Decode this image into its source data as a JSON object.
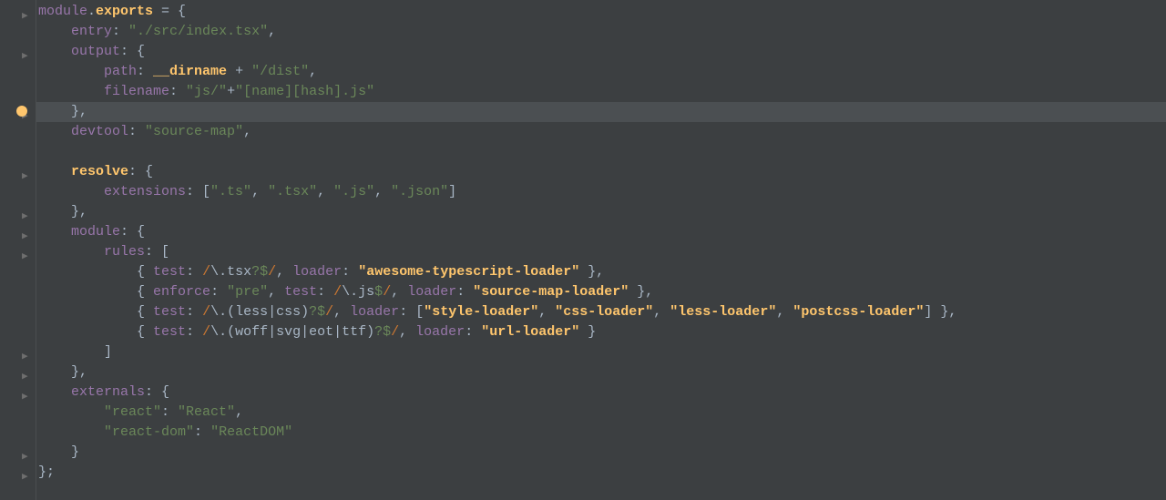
{
  "editor": {
    "lines": [
      {
        "indent": 0,
        "fold": true,
        "tokens": [
          {
            "t": "module",
            "c": "prop"
          },
          {
            "t": ".",
            "c": "punc"
          },
          {
            "t": "exports",
            "c": "hl"
          },
          {
            "t": " = {",
            "c": "plain"
          }
        ]
      },
      {
        "indent": 1,
        "tokens": [
          {
            "t": "entry",
            "c": "prop"
          },
          {
            "t": ": ",
            "c": "punc"
          },
          {
            "t": "\"./src/index.tsx\"",
            "c": "str"
          },
          {
            "t": ",",
            "c": "punc"
          }
        ]
      },
      {
        "indent": 1,
        "fold": true,
        "tokens": [
          {
            "t": "output",
            "c": "prop"
          },
          {
            "t": ": {",
            "c": "punc"
          }
        ]
      },
      {
        "indent": 2,
        "tokens": [
          {
            "t": "path",
            "c": "prop"
          },
          {
            "t": ": ",
            "c": "punc"
          },
          {
            "t": "__dirname",
            "c": "hl"
          },
          {
            "t": " + ",
            "c": "plain"
          },
          {
            "t": "\"/dist\"",
            "c": "str"
          },
          {
            "t": ",",
            "c": "punc"
          }
        ]
      },
      {
        "indent": 2,
        "tokens": [
          {
            "t": "filename",
            "c": "prop"
          },
          {
            "t": ": ",
            "c": "punc"
          },
          {
            "t": "\"js/\"",
            "c": "str"
          },
          {
            "t": "+",
            "c": "plain"
          },
          {
            "t": "\"[name][hash].js\"",
            "c": "str"
          }
        ]
      },
      {
        "indent": 1,
        "highlight": true,
        "bulb": true,
        "foldClose": true,
        "tokens": [
          {
            "t": "},",
            "c": "punc"
          }
        ]
      },
      {
        "indent": 1,
        "tokens": [
          {
            "t": "devtool",
            "c": "prop"
          },
          {
            "t": ": ",
            "c": "punc"
          },
          {
            "t": "\"source-map\"",
            "c": "str"
          },
          {
            "t": ",",
            "c": "punc"
          }
        ]
      },
      {
        "indent": 0,
        "tokens": []
      },
      {
        "indent": 1,
        "fold": true,
        "tokens": [
          {
            "t": "resolve",
            "c": "hl"
          },
          {
            "t": ": {",
            "c": "punc"
          }
        ]
      },
      {
        "indent": 2,
        "tokens": [
          {
            "t": "extensions",
            "c": "prop"
          },
          {
            "t": ": [",
            "c": "punc"
          },
          {
            "t": "\".ts\"",
            "c": "str"
          },
          {
            "t": ", ",
            "c": "punc"
          },
          {
            "t": "\".tsx\"",
            "c": "str"
          },
          {
            "t": ", ",
            "c": "punc"
          },
          {
            "t": "\".js\"",
            "c": "str"
          },
          {
            "t": ", ",
            "c": "punc"
          },
          {
            "t": "\".json\"",
            "c": "str"
          },
          {
            "t": "]",
            "c": "punc"
          }
        ]
      },
      {
        "indent": 1,
        "foldClose": true,
        "tokens": [
          {
            "t": "},",
            "c": "punc"
          }
        ]
      },
      {
        "indent": 1,
        "fold": true,
        "tokens": [
          {
            "t": "module",
            "c": "prop"
          },
          {
            "t": ": {",
            "c": "punc"
          }
        ]
      },
      {
        "indent": 2,
        "fold": true,
        "tokens": [
          {
            "t": "rules",
            "c": "prop"
          },
          {
            "t": ": [",
            "c": "punc"
          }
        ]
      },
      {
        "indent": 3,
        "tokens": [
          {
            "t": "{ ",
            "c": "punc"
          },
          {
            "t": "test",
            "c": "prop"
          },
          {
            "t": ": ",
            "c": "punc"
          },
          {
            "t": "/",
            "c": "regex"
          },
          {
            "t": "\\.tsx",
            "c": "rebody"
          },
          {
            "t": "?$",
            "c": "str"
          },
          {
            "t": "/",
            "c": "regex"
          },
          {
            "t": ", ",
            "c": "punc"
          },
          {
            "t": "loader",
            "c": "prop"
          },
          {
            "t": ": ",
            "c": "punc"
          },
          {
            "t": "\"awesome-typescript-loader\"",
            "c": "hlstr"
          },
          {
            "t": " },",
            "c": "punc"
          }
        ]
      },
      {
        "indent": 3,
        "tokens": [
          {
            "t": "{ ",
            "c": "punc"
          },
          {
            "t": "enforce",
            "c": "prop"
          },
          {
            "t": ": ",
            "c": "punc"
          },
          {
            "t": "\"pre\"",
            "c": "str"
          },
          {
            "t": ", ",
            "c": "punc"
          },
          {
            "t": "test",
            "c": "prop"
          },
          {
            "t": ": ",
            "c": "punc"
          },
          {
            "t": "/",
            "c": "regex"
          },
          {
            "t": "\\.js",
            "c": "rebody"
          },
          {
            "t": "$",
            "c": "str"
          },
          {
            "t": "/",
            "c": "regex"
          },
          {
            "t": ", ",
            "c": "punc"
          },
          {
            "t": "loader",
            "c": "prop"
          },
          {
            "t": ": ",
            "c": "punc"
          },
          {
            "t": "\"source-map-loader\"",
            "c": "hlstr"
          },
          {
            "t": " },",
            "c": "punc"
          }
        ]
      },
      {
        "indent": 3,
        "tokens": [
          {
            "t": "{ ",
            "c": "punc"
          },
          {
            "t": "test",
            "c": "prop"
          },
          {
            "t": ": ",
            "c": "punc"
          },
          {
            "t": "/",
            "c": "regex"
          },
          {
            "t": "\\.(less|css)",
            "c": "rebody"
          },
          {
            "t": "?$",
            "c": "str"
          },
          {
            "t": "/",
            "c": "regex"
          },
          {
            "t": ", ",
            "c": "punc"
          },
          {
            "t": "loader",
            "c": "prop"
          },
          {
            "t": ": [",
            "c": "punc"
          },
          {
            "t": "\"style-loader\"",
            "c": "hlstr"
          },
          {
            "t": ", ",
            "c": "punc"
          },
          {
            "t": "\"css-loader\"",
            "c": "hlstr"
          },
          {
            "t": ", ",
            "c": "punc"
          },
          {
            "t": "\"less-loader\"",
            "c": "hlstr"
          },
          {
            "t": ", ",
            "c": "punc"
          },
          {
            "t": "\"postcss-loader\"",
            "c": "hlstr"
          },
          {
            "t": "] },",
            "c": "punc"
          }
        ]
      },
      {
        "indent": 3,
        "tokens": [
          {
            "t": "{ ",
            "c": "punc"
          },
          {
            "t": "test",
            "c": "prop"
          },
          {
            "t": ": ",
            "c": "punc"
          },
          {
            "t": "/",
            "c": "regex"
          },
          {
            "t": "\\.(woff|svg|eot|ttf)",
            "c": "rebody"
          },
          {
            "t": "?$",
            "c": "str"
          },
          {
            "t": "/",
            "c": "regex"
          },
          {
            "t": ", ",
            "c": "punc"
          },
          {
            "t": "loader",
            "c": "prop"
          },
          {
            "t": ": ",
            "c": "punc"
          },
          {
            "t": "\"url-loader\"",
            "c": "hlstr"
          },
          {
            "t": " }",
            "c": "punc"
          }
        ]
      },
      {
        "indent": 2,
        "foldClose": true,
        "tokens": [
          {
            "t": "]",
            "c": "punc"
          }
        ]
      },
      {
        "indent": 1,
        "foldClose": true,
        "tokens": [
          {
            "t": "},",
            "c": "punc"
          }
        ]
      },
      {
        "indent": 1,
        "fold": true,
        "tokens": [
          {
            "t": "externals",
            "c": "prop"
          },
          {
            "t": ": {",
            "c": "punc"
          }
        ]
      },
      {
        "indent": 2,
        "tokens": [
          {
            "t": "\"react\"",
            "c": "str"
          },
          {
            "t": ": ",
            "c": "punc"
          },
          {
            "t": "\"React\"",
            "c": "str"
          },
          {
            "t": ",",
            "c": "punc"
          }
        ]
      },
      {
        "indent": 2,
        "tokens": [
          {
            "t": "\"react-dom\"",
            "c": "str"
          },
          {
            "t": ": ",
            "c": "punc"
          },
          {
            "t": "\"ReactDOM\"",
            "c": "str"
          }
        ]
      },
      {
        "indent": 1,
        "foldClose": true,
        "tokens": [
          {
            "t": "}",
            "c": "punc"
          }
        ]
      },
      {
        "indent": 0,
        "foldClose": true,
        "tokens": [
          {
            "t": "};",
            "c": "punc"
          }
        ]
      }
    ]
  }
}
